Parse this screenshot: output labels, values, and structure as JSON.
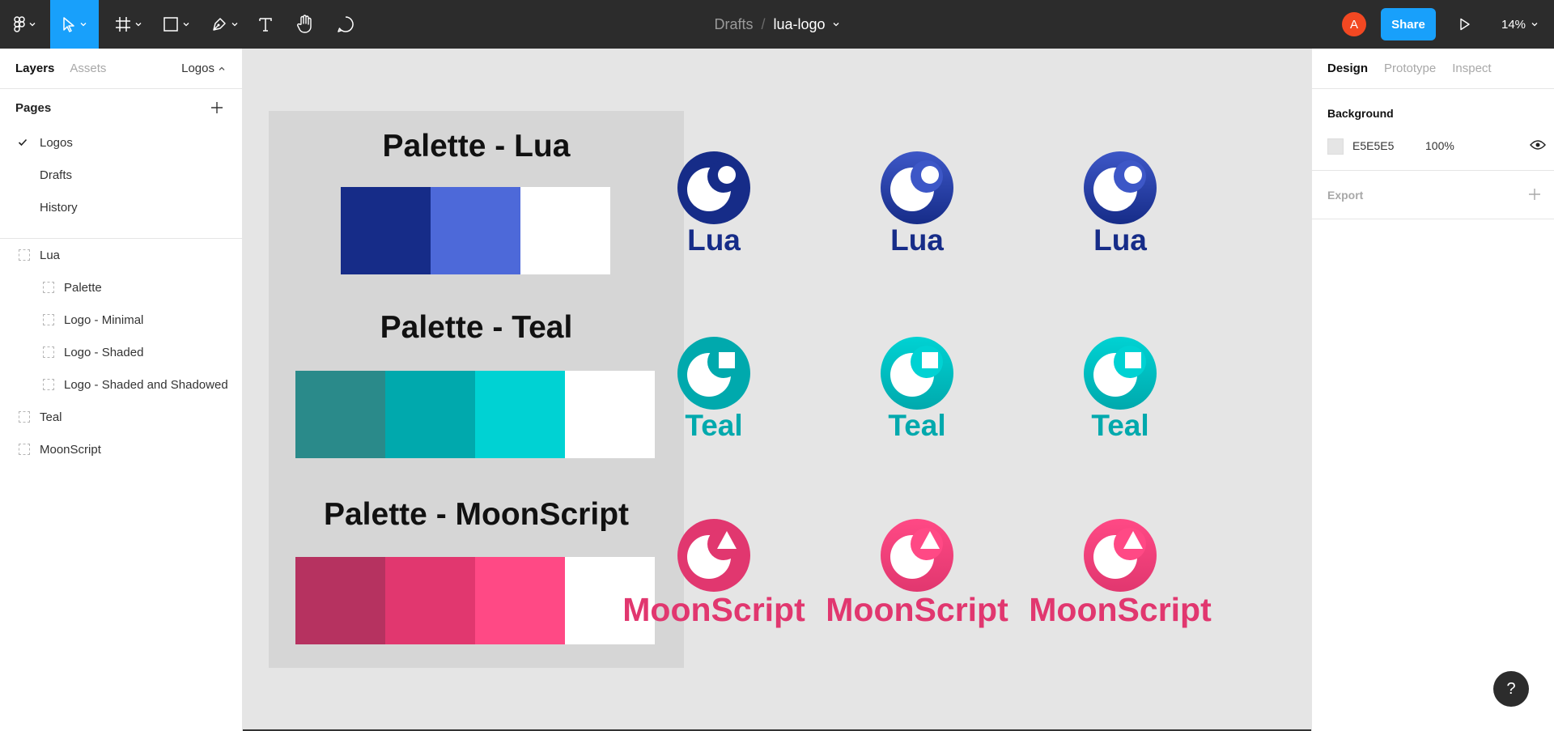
{
  "toolbar": {
    "tools": [
      "main-menu",
      "move",
      "frame",
      "shape",
      "pen",
      "text",
      "hand",
      "comment"
    ],
    "active_tool": "move",
    "breadcrumb": {
      "folder": "Drafts",
      "separator": "/",
      "file": "lua-logo"
    },
    "avatar_initial": "A",
    "share_label": "Share",
    "zoom_label": "14%"
  },
  "left_panel": {
    "tabs": {
      "layers": "Layers",
      "assets": "Assets"
    },
    "page_selector": "Logos",
    "pages_title": "Pages",
    "pages": [
      {
        "label": "Logos",
        "selected": true
      },
      {
        "label": "Drafts",
        "selected": false
      },
      {
        "label": "History",
        "selected": false
      }
    ],
    "layers": [
      {
        "label": "Lua",
        "level": 0
      },
      {
        "label": "Palette",
        "level": 1
      },
      {
        "label": "Logo - Minimal",
        "level": 1
      },
      {
        "label": "Logo - Shaded",
        "level": 1
      },
      {
        "label": "Logo - Shaded and Shadowed",
        "level": 1
      },
      {
        "label": "Teal",
        "level": 0
      },
      {
        "label": "MoonScript",
        "level": 0
      }
    ]
  },
  "canvas": {
    "background": "#E5E5E5",
    "palettes": [
      {
        "title": "Palette - Lua",
        "colors": [
          "#162c88",
          "#4d69d9",
          "#ffffff"
        ]
      },
      {
        "title": "Palette - Teal",
        "colors": [
          "#2a8a8a",
          "#00a9ad",
          "#00d2d3",
          "#ffffff"
        ]
      },
      {
        "title": "Palette - MoonScript",
        "colors": [
          "#b63260",
          "#e1376f",
          "#ff4985",
          "#ffffff"
        ]
      }
    ],
    "logos": [
      {
        "name": "Lua",
        "variants": [
          "minimal",
          "shaded",
          "shaded-shadowed"
        ],
        "color": "#162c88",
        "light": "#3d57c7",
        "mark": "circle"
      },
      {
        "name": "Teal",
        "variants": [
          "minimal",
          "shaded",
          "shaded-shadowed"
        ],
        "color": "#00a9ad",
        "light": "#00d2d3",
        "mark": "square"
      },
      {
        "name": "MoonScript",
        "variants": [
          "minimal",
          "shaded",
          "shaded-shadowed"
        ],
        "color": "#e1376f",
        "light": "#ff4985",
        "mark": "triangle"
      }
    ]
  },
  "right_panel": {
    "tabs": {
      "design": "Design",
      "prototype": "Prototype",
      "inspect": "Inspect"
    },
    "background": {
      "title": "Background",
      "hex": "E5E5E5",
      "opacity": "100%",
      "swatch": "#E5E5E5"
    },
    "export": {
      "title": "Export"
    }
  },
  "help_label": "?"
}
